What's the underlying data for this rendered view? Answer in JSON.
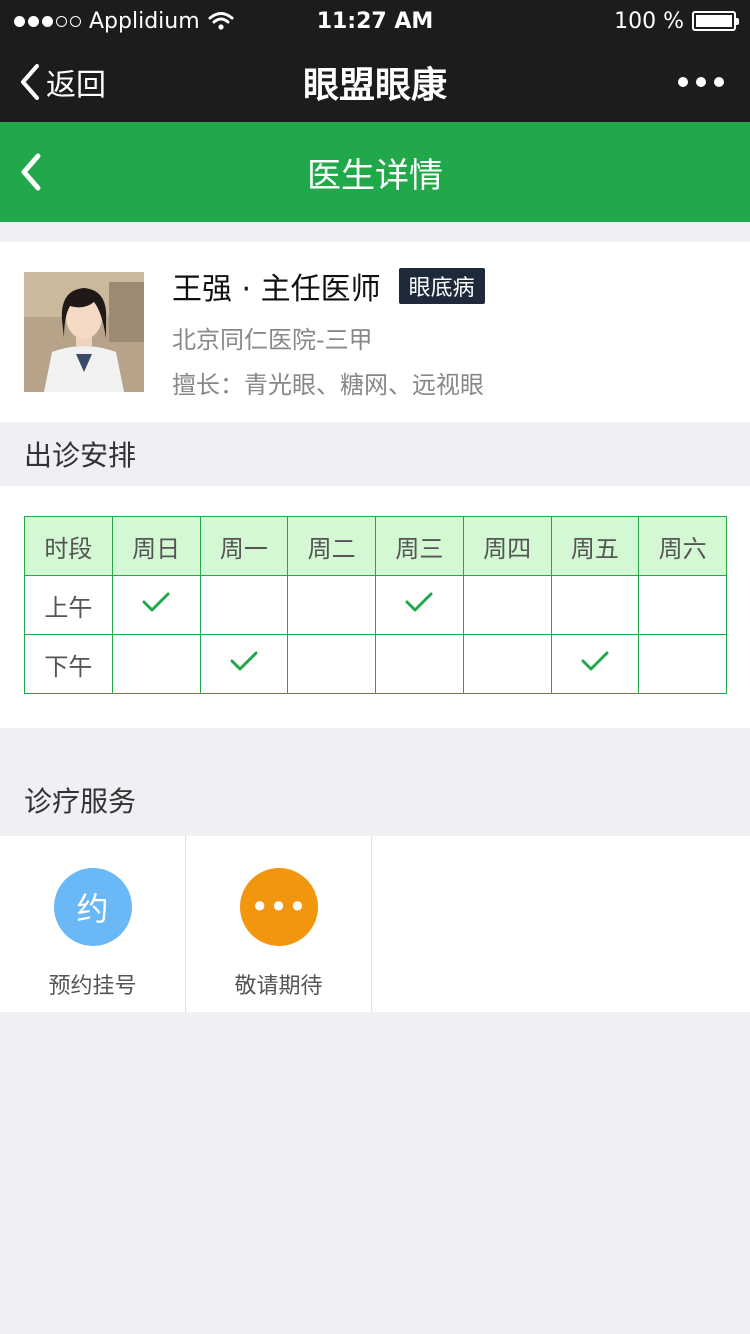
{
  "status_bar": {
    "carrier": "Applidium",
    "time": "11:27 AM",
    "battery_text": "100 %",
    "signal_filled": 3,
    "signal_total": 5
  },
  "nav_bar": {
    "back_label": "返回",
    "title": "眼盟眼康",
    "more_icon": "more-icon"
  },
  "page_header": {
    "title": "医生详情",
    "back_icon": "chevron-left-icon"
  },
  "doctor": {
    "name": "王强 · 主任医师",
    "badge": "眼底病",
    "hospital": "北京同仁医院-三甲",
    "specialty": "擅长：青光眼、糖网、远视眼"
  },
  "schedule": {
    "title": "出诊安排",
    "header": [
      "时段",
      "周日",
      "周一",
      "周二",
      "周三",
      "周四",
      "周五",
      "周六"
    ],
    "rows": [
      {
        "label": "上午",
        "slots": [
          true,
          false,
          false,
          true,
          false,
          false,
          false
        ]
      },
      {
        "label": "下午",
        "slots": [
          false,
          true,
          false,
          false,
          false,
          true,
          false
        ]
      }
    ]
  },
  "services": {
    "title": "诊疗服务",
    "items": [
      {
        "icon_text": "约",
        "label": "预约挂号",
        "color": "#6bb8f6"
      },
      {
        "icon_text": "•••",
        "label": "敬请期待",
        "color": "#f2950f"
      }
    ]
  },
  "colors": {
    "green": "#21a84a",
    "dark": "#1c1c1e",
    "header_cell": "#d4f8d4"
  }
}
